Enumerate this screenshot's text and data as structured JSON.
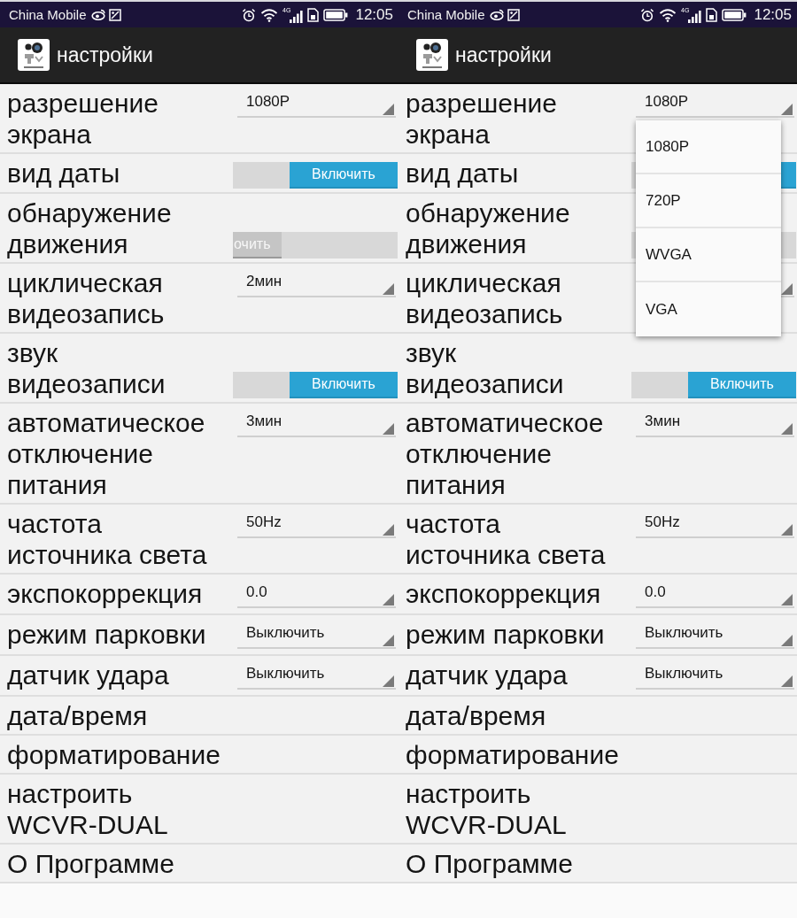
{
  "screens": [
    {
      "status_bar": {
        "carrier": "China Mobile",
        "network": "4G",
        "time": "12:05"
      },
      "app_bar": {
        "title": "настройки"
      },
      "settings": [
        {
          "kind": "dropdown",
          "label": "разрешение экрана",
          "value": "1080P"
        },
        {
          "kind": "toggle",
          "label": "вид даты",
          "on": true,
          "thumb_text": "Включить"
        },
        {
          "kind": "toggle",
          "label": "обнаружение движения",
          "on": false,
          "thumb_text": "очить"
        },
        {
          "kind": "dropdown",
          "label": "циклическая видеозапись",
          "value": "2мин"
        },
        {
          "kind": "toggle",
          "label": "звук видеозаписи",
          "on": true,
          "thumb_text": "Включить"
        },
        {
          "kind": "dropdown",
          "label": "автоматическое отключение питания",
          "value": "3мин"
        },
        {
          "kind": "dropdown",
          "label": "частота источника света",
          "value": "50Hz"
        },
        {
          "kind": "dropdown",
          "label": "экспокоррекция",
          "value": "0.0"
        },
        {
          "kind": "dropdown",
          "label": "режим парковки",
          "value": "Выключить"
        },
        {
          "kind": "dropdown",
          "label": "датчик удара",
          "value": "Выключить"
        },
        {
          "kind": "item",
          "label": "дата/время"
        },
        {
          "kind": "item",
          "label": "форматирование"
        },
        {
          "kind": "item",
          "label": "настроить WCVR-DUAL"
        },
        {
          "kind": "item",
          "label": "О Программе"
        }
      ]
    },
    {
      "status_bar": {
        "carrier": "China Mobile",
        "network": "4G",
        "time": "12:05"
      },
      "app_bar": {
        "title": "настройки"
      },
      "settings": [
        {
          "kind": "dropdown",
          "label": "разрешение экрана",
          "value": "1080P",
          "options": [
            "1080P",
            "720P",
            "WVGA",
            "VGA"
          ]
        },
        {
          "kind": "toggle",
          "label": "вид даты",
          "on": true
        },
        {
          "kind": "toggle",
          "label": "обнаружение движения",
          "on": false
        },
        {
          "kind": "dropdown",
          "label": "циклическая видеозапись"
        },
        {
          "kind": "toggle",
          "label": "звук видеозаписи",
          "on": true,
          "thumb_text": "Включить"
        },
        {
          "kind": "dropdown",
          "label": "автоматическое отключение питания",
          "value": "3мин"
        },
        {
          "kind": "dropdown",
          "label": "частота источника света",
          "value": "50Hz"
        },
        {
          "kind": "dropdown",
          "label": "экспокоррекция",
          "value": "0.0"
        },
        {
          "kind": "dropdown",
          "label": "режим парковки",
          "value": "Выключить"
        },
        {
          "kind": "dropdown",
          "label": "датчик удара",
          "value": "Выключить"
        },
        {
          "kind": "item",
          "label": "дата/время"
        },
        {
          "kind": "item",
          "label": "форматирование"
        },
        {
          "kind": "item",
          "label": "настроить WCVR-DUAL"
        },
        {
          "kind": "item",
          "label": "О Программе"
        }
      ]
    }
  ]
}
